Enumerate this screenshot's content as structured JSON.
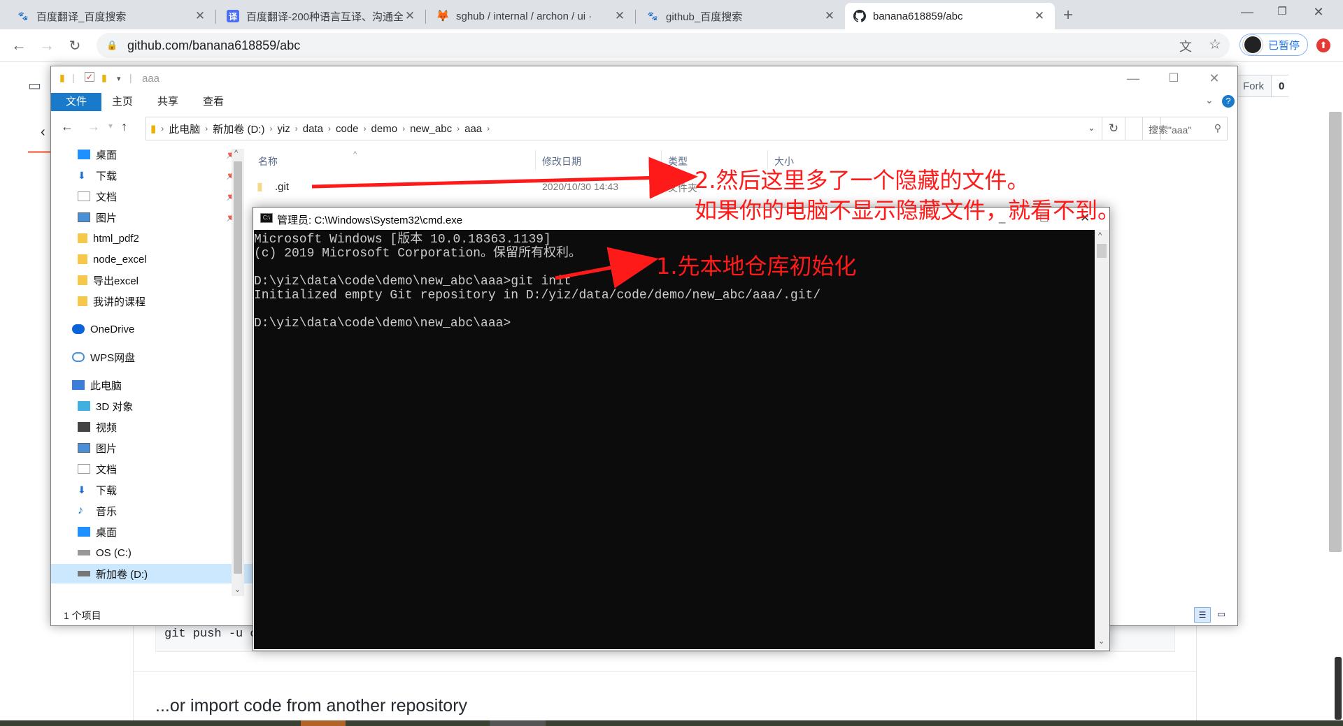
{
  "browser": {
    "tabs": [
      {
        "title": "百度翻译_百度搜索",
        "favicon": "baidu-paw-icon",
        "active": false
      },
      {
        "title": "百度翻译-200种语言互译、沟通全",
        "favicon": "baidu-translate-icon",
        "active": false
      },
      {
        "title": "sghub / internal / archon / ui ·",
        "favicon": "gitlab-fox-icon",
        "active": false
      },
      {
        "title": "github_百度搜索",
        "favicon": "baidu-paw-icon",
        "active": false
      },
      {
        "title": "banana618859/abc",
        "favicon": "github-octocat-icon",
        "active": true
      }
    ],
    "url": "github.com/banana618859/abc",
    "profile_label": "已暂停"
  },
  "github": {
    "fork_label": "Fork",
    "fork_count": "0",
    "code_snippet": "git push -u or",
    "import_heading": "...or import code from another repository"
  },
  "explorer": {
    "title": "aaa",
    "ribbon_tabs": [
      "文件",
      "主页",
      "共享",
      "查看"
    ],
    "breadcrumbs": [
      "此电脑",
      "新加卷 (D:)",
      "yiz",
      "data",
      "code",
      "demo",
      "new_abc",
      "aaa"
    ],
    "search_placeholder": "搜索\"aaa\"",
    "nav_items": [
      {
        "label": "桌面",
        "icon": "desktop-icon",
        "pinned": true
      },
      {
        "label": "下载",
        "icon": "download-icon",
        "pinned": true
      },
      {
        "label": "文档",
        "icon": "document-icon",
        "pinned": true
      },
      {
        "label": "图片",
        "icon": "pictures-icon",
        "pinned": true
      },
      {
        "label": "html_pdf2",
        "icon": "folder-icon",
        "pinned": false
      },
      {
        "label": "node_excel",
        "icon": "folder-icon",
        "pinned": false
      },
      {
        "label": "导出excel",
        "icon": "folder-icon",
        "pinned": false
      },
      {
        "label": "我讲的课程",
        "icon": "folder-icon",
        "pinned": false
      },
      {
        "label": "OneDrive",
        "icon": "onedrive-cloud-icon",
        "pinned": false
      },
      {
        "label": "WPS网盘",
        "icon": "wps-cloud-icon",
        "pinned": false
      },
      {
        "label": "此电脑",
        "icon": "this-pc-icon",
        "pinned": false
      },
      {
        "label": "3D 对象",
        "icon": "3d-objects-icon",
        "pinned": false
      },
      {
        "label": "视频",
        "icon": "video-icon",
        "pinned": false
      },
      {
        "label": "图片",
        "icon": "pictures-icon",
        "pinned": false
      },
      {
        "label": "文档",
        "icon": "document-icon",
        "pinned": false
      },
      {
        "label": "下载",
        "icon": "download-icon",
        "pinned": false
      },
      {
        "label": "音乐",
        "icon": "music-icon",
        "pinned": false
      },
      {
        "label": "桌面",
        "icon": "desktop-icon",
        "pinned": false
      },
      {
        "label": "OS (C:)",
        "icon": "drive-c-icon",
        "pinned": false
      },
      {
        "label": "新加卷 (D:)",
        "icon": "drive-d-icon",
        "pinned": false,
        "selected": true
      }
    ],
    "columns": [
      "名称",
      "修改日期",
      "类型",
      "大小"
    ],
    "files": [
      {
        "name": ".git",
        "modified": "2020/10/30 14:43",
        "type": "文件夹",
        "size": ""
      }
    ],
    "status_text": "1 个项目"
  },
  "cmd": {
    "title": "管理员: C:\\Windows\\System32\\cmd.exe",
    "lines": [
      "Microsoft Windows [版本 10.0.18363.1139]",
      "(c) 2019 Microsoft Corporation。保留所有权利。",
      "",
      "D:\\yiz\\data\\code\\demo\\new_abc\\aaa>git init",
      "Initialized empty Git repository in D:/yiz/data/code/demo/new_abc/aaa/.git/",
      "",
      "D:\\yiz\\data\\code\\demo\\new_abc\\aaa>"
    ]
  },
  "annotations": {
    "note1": "1.先本地仓库初始化",
    "note2_line1": "2.然后这里多了一个隐藏的文件。",
    "note2_line2": "如果你的电脑不显示隐藏文件，就看不到。",
    "color": "#ff1a1a"
  },
  "colors": {
    "explorer_accent": "#1979ca",
    "tabstrip_bg": "#dee1e6",
    "cmd_bg": "#0c0c0c",
    "cmd_fg": "#cccccc"
  }
}
